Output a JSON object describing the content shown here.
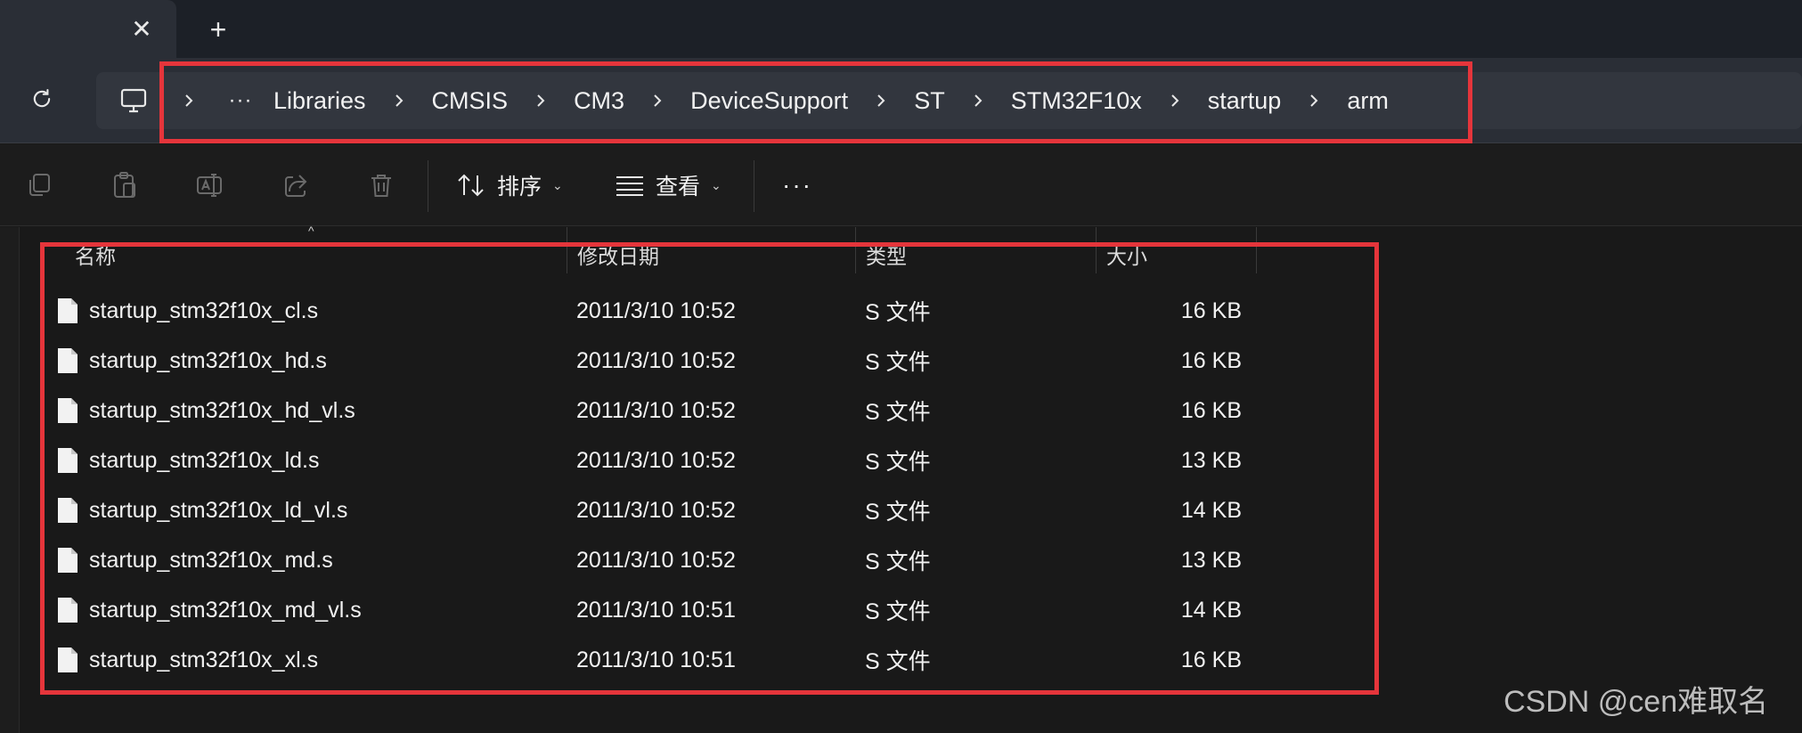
{
  "titlebar": {
    "close_glyph": "✕",
    "new_tab_glyph": "+"
  },
  "address_bar": {
    "overflow_label": "···",
    "breadcrumbs": [
      "Libraries",
      "CMSIS",
      "CM3",
      "DeviceSupport",
      "ST",
      "STM32F10x",
      "startup",
      "arm"
    ]
  },
  "toolbar": {
    "sort_label": "排序",
    "view_label": "查看",
    "more_label": "···"
  },
  "columns": {
    "name": "名称",
    "date": "修改日期",
    "type": "类型",
    "size": "大小"
  },
  "files": [
    {
      "name": "startup_stm32f10x_cl.s",
      "date": "2011/3/10 10:52",
      "type": "S 文件",
      "size": "16 KB"
    },
    {
      "name": "startup_stm32f10x_hd.s",
      "date": "2011/3/10 10:52",
      "type": "S 文件",
      "size": "16 KB"
    },
    {
      "name": "startup_stm32f10x_hd_vl.s",
      "date": "2011/3/10 10:52",
      "type": "S 文件",
      "size": "16 KB"
    },
    {
      "name": "startup_stm32f10x_ld.s",
      "date": "2011/3/10 10:52",
      "type": "S 文件",
      "size": "13 KB"
    },
    {
      "name": "startup_stm32f10x_ld_vl.s",
      "date": "2011/3/10 10:52",
      "type": "S 文件",
      "size": "14 KB"
    },
    {
      "name": "startup_stm32f10x_md.s",
      "date": "2011/3/10 10:52",
      "type": "S 文件",
      "size": "13 KB"
    },
    {
      "name": "startup_stm32f10x_md_vl.s",
      "date": "2011/3/10 10:51",
      "type": "S 文件",
      "size": "14 KB"
    },
    {
      "name": "startup_stm32f10x_xl.s",
      "date": "2011/3/10 10:51",
      "type": "S 文件",
      "size": "16 KB"
    }
  ],
  "watermark": "CSDN @cen难取名",
  "colors": {
    "highlight": "#e5353b",
    "background": "#191919",
    "addressbar": "#2a2e36"
  }
}
